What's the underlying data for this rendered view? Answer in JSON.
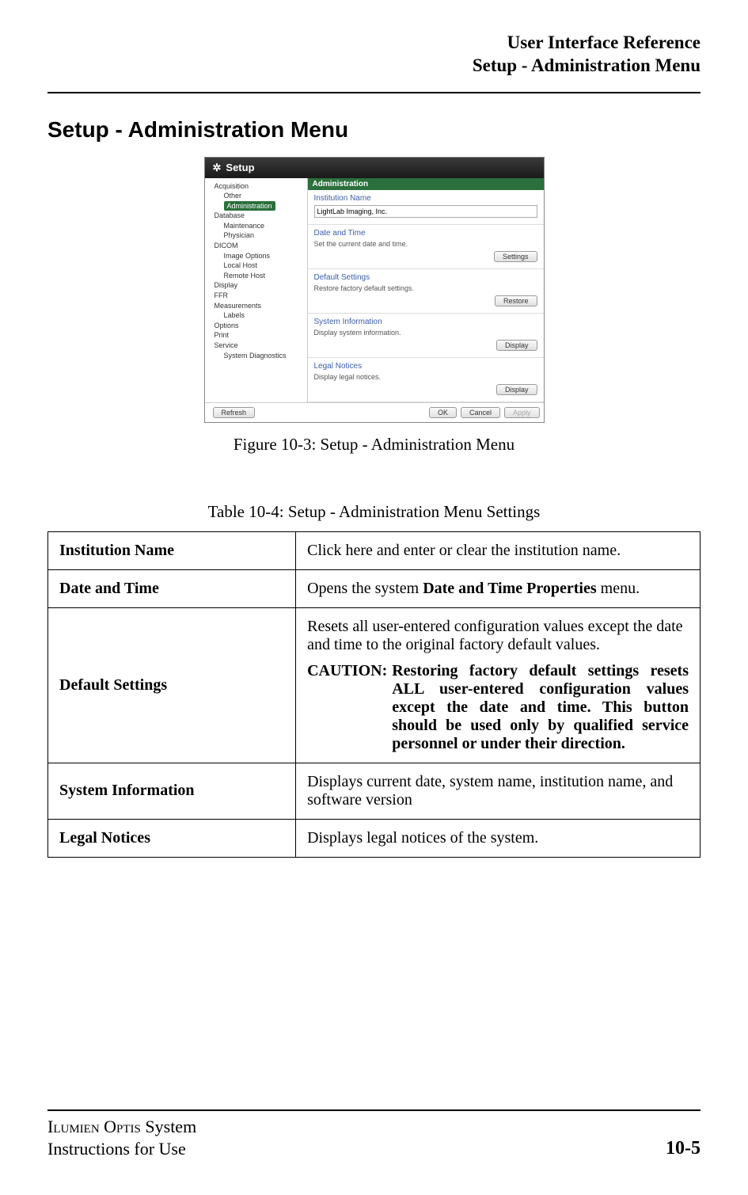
{
  "header": {
    "line1": "User Interface Reference",
    "line2": "Setup - Administration Menu"
  },
  "section_title": "Setup - Administration Menu",
  "figure": {
    "window_title": "Setup",
    "tree": {
      "acquisition": "Acquisition",
      "other": "Other",
      "administration": "Administration",
      "database": "Database",
      "maintenance": "Maintenance",
      "physician": "Physician",
      "dicom": "DICOM",
      "image_options": "Image Options",
      "local_host": "Local Host",
      "remote_host": "Remote Host",
      "display": "Display",
      "ffr": "FFR",
      "measurements": "Measurements",
      "labels": "Labels",
      "options": "Options",
      "print": "Print",
      "service": "Service",
      "system_diagnostics": "System Diagnostics"
    },
    "panel": {
      "header": "Administration",
      "institution_label": "Institution Name",
      "institution_value": "LightLab Imaging, Inc.",
      "datetime_label": "Date and Time",
      "datetime_desc": "Set the current date and time.",
      "settings_btn": "Settings",
      "default_label": "Default Settings",
      "default_desc": "Restore factory default settings.",
      "restore_btn": "Restore",
      "sysinfo_label": "System Information",
      "sysinfo_desc": "Display system information.",
      "display_btn": "Display",
      "legal_label": "Legal Notices",
      "legal_desc": "Display legal notices.",
      "display_btn2": "Display"
    },
    "footer": {
      "refresh": "Refresh",
      "ok": "OK",
      "cancel": "Cancel",
      "apply": "Apply"
    },
    "caption": "Figure 10-3:  Setup - Administration Menu"
  },
  "table": {
    "caption": "Table 10-4:  Setup - Administration Menu Settings",
    "rows": {
      "institution_name": {
        "key": "Institution Name",
        "val": "Click here and enter or clear the institution name."
      },
      "date_and_time": {
        "key": "Date and Time",
        "val_pre": "Opens the system ",
        "val_bold": "Date and Time Properties",
        "val_post": " menu."
      },
      "default_settings": {
        "key": "Default Settings",
        "val1": "Resets all user-entered configuration values except the date and time to the original factory default values.",
        "caution_label": "CAUTION:",
        "caution_text": "Restoring factory default settings resets ALL user-entered configuration values except the date and time. This button should be used only by qualified service personnel or under their direction."
      },
      "system_information": {
        "key": "System Information",
        "val": "Displays current date, system name, institution name, and software version"
      },
      "legal_notices": {
        "key": "Legal Notices",
        "val": "Displays legal notices of the system."
      }
    }
  },
  "footer": {
    "line1_pre": "I",
    "line1_sc1": "lumien",
    "line1_mid": " O",
    "line1_sc2": "ptis",
    "line1_post": " System",
    "line2": "Instructions for Use",
    "page": "10-5"
  }
}
